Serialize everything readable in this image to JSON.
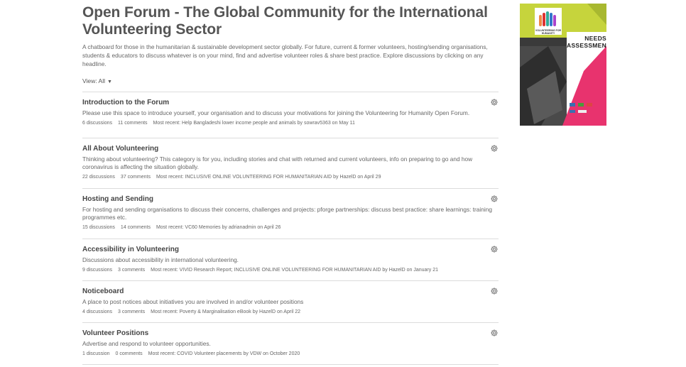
{
  "forum": {
    "title": "Open Forum - The Global Community for the International Volunteering Sector",
    "intro": "A chatboard for those in the humanitarian & sustainable development sector globally. For future, current & former volunteers, hosting/sending organisations, students & educators to discuss whatever is on your mind, find and advertise volunteer roles & share best practice. Explore discussions by clicking on any headline.",
    "view_label": "View: All",
    "view_arrow": "▼"
  },
  "categories": [
    {
      "name": "Introduction to the Forum",
      "description": "Please use this space to introduce yourself, your organisation and to discuss your motivations for joining the Volunteering for Humanity Open Forum.",
      "discussions": "6 discussions",
      "comments": "11 comments",
      "recent": "Most recent: Help Bangladeshi lower income people and animals by sowrav5363 on May 11"
    },
    {
      "name": "All About Volunteering",
      "description": "Thinking about volunteering? This category is for you, including stories and chat with returned and current volunteers, info on preparing to go and how coronavirus is affecting the situation globally.",
      "discussions": "22 discussions",
      "comments": "37 comments",
      "recent": "Most recent: INCLUSIVE ONLINE VOLUNTEERING FOR HUMANITARIAN AID by HazelD on April 29"
    },
    {
      "name": "Hosting and Sending",
      "description": "For hosting and sending organisations to discuss their concerns, challenges and projects: pforge partnerships: discuss best practice: share learnings: training programmes etc.",
      "discussions": "15 discussions",
      "comments": "14 comments",
      "recent": "Most recent: VC60 Memories by adrianadmin on April 26"
    },
    {
      "name": "Accessibility in Volunteering",
      "description": "Discussions about accessibility in international volunteering.",
      "discussions": "9 discussions",
      "comments": "3 comments",
      "recent": "Most recent: VIVID Research Report; INCLUSIVE ONLINE VOLUNTEERING FOR HUMANITARIAN AID by HazelD on January 21"
    },
    {
      "name": "Noticeboard",
      "description": "A place to post notices about initiatives you are involved in and/or volunteer positions",
      "discussions": "4 discussions",
      "comments": "3 comments",
      "recent": "Most recent: Poverty & Marginalisation eBook by HazelD on April 22"
    },
    {
      "name": "Volunteer Positions",
      "description": "Advertise and respond to volunteer opportunities.",
      "discussions": "1 discussion",
      "comments": "0 comments",
      "recent": "Most recent: COVID Volunteer placements by VDW on October 2020"
    }
  ],
  "sidebar_ad": {
    "heading": "NEEDS ASSESSMENT",
    "logo_text": "VOLUNTEERING FOR HUMANITY",
    "colors": {
      "green": "#c6d43c",
      "pink": "#e8336e",
      "dark": "#2b2b2b"
    }
  },
  "icons": {
    "category_options": "gear-icon"
  }
}
